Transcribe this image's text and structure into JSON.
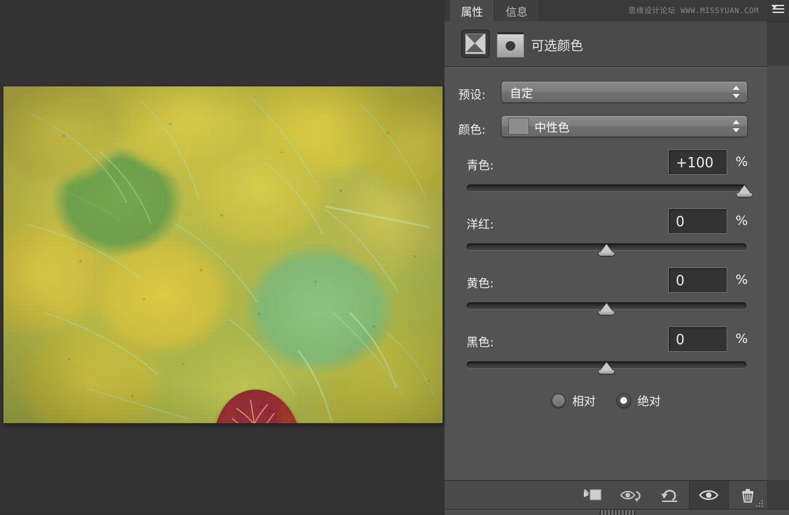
{
  "app": {
    "bg_color": "#343434",
    "panel_bg": "#535353",
    "header_bg": "#4a4a4a"
  },
  "watermark": {
    "text": "思缘设计论坛 WWW.MISSYUAN.COM"
  },
  "tabs": [
    {
      "label": "属性",
      "active": true,
      "name": "tab-properties"
    },
    {
      "label": "信息",
      "active": false,
      "name": "tab-info"
    }
  ],
  "panel": {
    "title": "可选颜色",
    "adjustment_icon": "selective-color-icon",
    "mask_thumbnail": "layer-mask-thumbnail"
  },
  "fields": {
    "preset": {
      "label": "预设:",
      "value": "自定"
    },
    "colors": {
      "label": "颜色:",
      "value": "中性色",
      "swatch_color": "#8d8d8d"
    }
  },
  "sliders": [
    {
      "label": "青色:",
      "value": "+100",
      "unit": "%",
      "percent": 100,
      "min": -100,
      "max": 100,
      "name": "cyan"
    },
    {
      "label": "洋红:",
      "value": "0",
      "unit": "%",
      "percent": 50,
      "min": -100,
      "max": 100,
      "name": "magenta"
    },
    {
      "label": "黄色:",
      "value": "0",
      "unit": "%",
      "percent": 50,
      "min": -100,
      "max": 100,
      "name": "yellow"
    },
    {
      "label": "黑色:",
      "value": "0",
      "unit": "%",
      "percent": 50,
      "min": -100,
      "max": 100,
      "name": "black"
    }
  ],
  "method": {
    "relative": {
      "label": "相对",
      "checked": false
    },
    "absolute": {
      "label": "绝对",
      "checked": true
    }
  },
  "footer": {
    "icons": [
      {
        "name": "clip-to-layer-icon",
        "active": false
      },
      {
        "name": "toggle-previous-state-icon",
        "active": false
      },
      {
        "name": "reset-icon",
        "active": false
      },
      {
        "name": "visibility-eye-icon",
        "active": true
      },
      {
        "name": "delete-trash-icon",
        "active": false
      }
    ]
  },
  "document": {
    "image_description": "aspen-leaves-photo"
  }
}
